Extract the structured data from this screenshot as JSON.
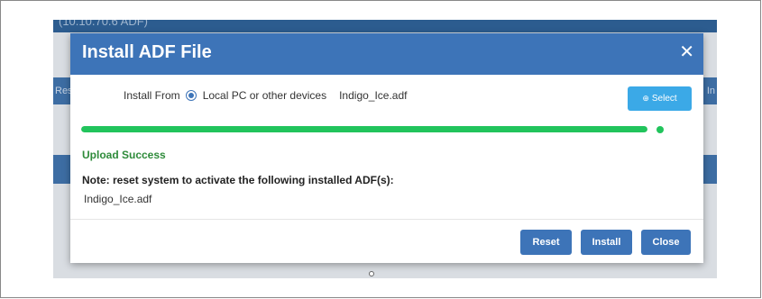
{
  "background": {
    "title_fragment": "(10.10.70.6 ADF)",
    "band1_left": "Res",
    "band1_right": "In"
  },
  "modal": {
    "title": "Install ADF File",
    "close_glyph": "✕",
    "install_from_label": "Install From",
    "source_option": "Local PC or other devices",
    "selected_file": "Indigo_Ice.adf",
    "select_button": {
      "icon": "upload-icon",
      "glyph": "⊕",
      "label": "Select"
    },
    "progress": {
      "value": 1.0,
      "color": "#21c45c"
    },
    "status_text": "Upload Success",
    "note": "Note: reset system to activate the following installed ADF(s):",
    "installed_files": [
      "Indigo_Ice.adf"
    ],
    "buttons": {
      "reset": "Reset",
      "install": "Install",
      "close": "Close"
    }
  },
  "colors": {
    "header": "#3d74b8",
    "primary_button": "#3d74b8",
    "select_button": "#3ba9e7",
    "success": "#2e8b3a"
  }
}
